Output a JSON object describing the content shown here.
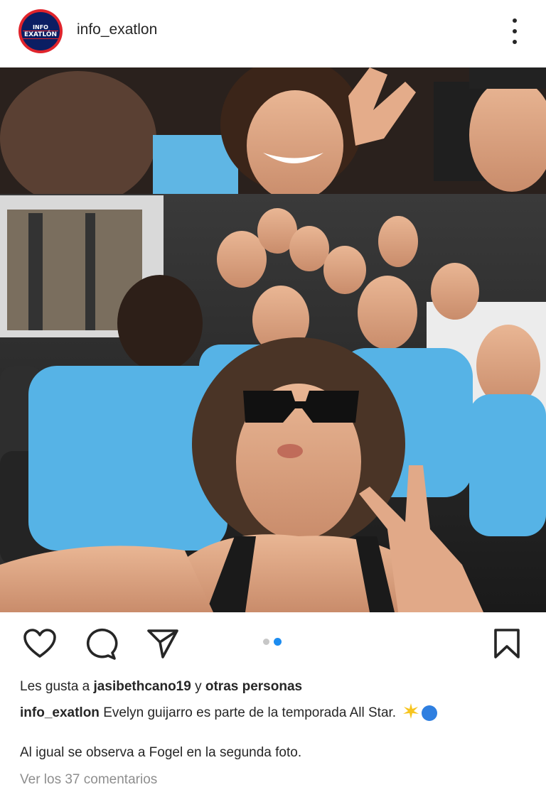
{
  "header": {
    "avatar_text_top": "INFO",
    "avatar_text_bottom": "EXATLÓN",
    "username": "info_exatlon"
  },
  "post": {
    "carousel": {
      "slide_count": 2,
      "active_index": 1
    },
    "likes_prefix": "Les gusta a",
    "likes_user": "jasibethcano19",
    "likes_mid": "y",
    "likes_others": "otras personas",
    "caption_user": "info_exatlon",
    "caption_text": "Evelyn guijarro es parte de la temporada All Star.",
    "caption_line2": "Al igual se observa a Fogel en la segunda foto.",
    "view_comments": "Ver los 37 comentarios"
  },
  "icons": {
    "like": "heart-icon",
    "comment": "comment-bubble-icon",
    "share": "send-icon",
    "save": "bookmark-icon",
    "emoji1": "sparkle-star-emoji",
    "emoji2": "blue-circle-emoji"
  },
  "colors": {
    "text": "#262626",
    "muted": "#8e8e8e",
    "carousel_active": "#1d8cf0",
    "carousel_inactive": "#c7c7c7",
    "shirt_blue": "#56b3e6"
  }
}
